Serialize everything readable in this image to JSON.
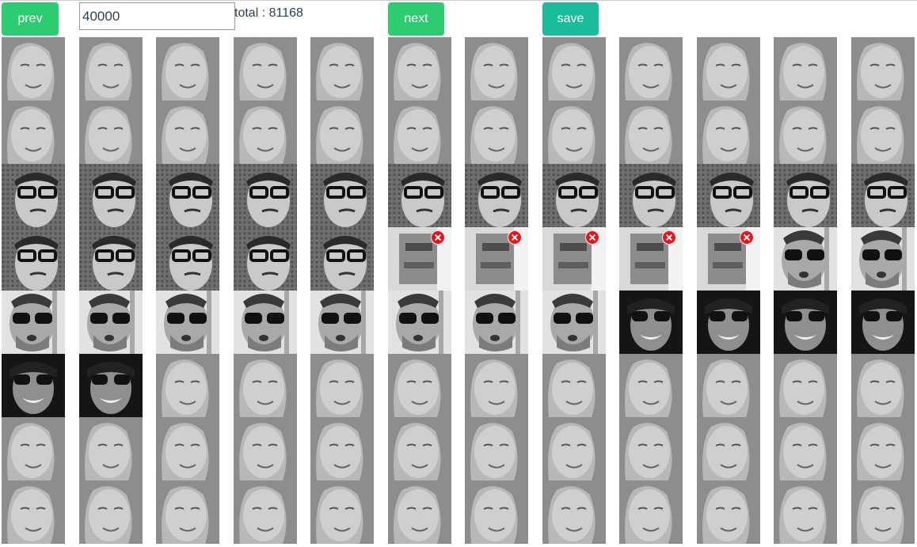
{
  "toolbar": {
    "prev_label": "prev",
    "next_label": "next",
    "save_label": "save",
    "page_value": "40000",
    "total_text": "total : 81168"
  },
  "colors": {
    "prev": "#2ecc71",
    "next": "#2ecc71",
    "save": "#1abc9c",
    "reject_mark": "#e8141c"
  },
  "grid": {
    "columns": 12,
    "rows": 8,
    "tiles": [
      [
        "blonde-woman",
        "blonde-woman",
        "blonde-woman",
        "blonde-woman",
        "blonde-woman",
        "blonde-woman",
        "blonde-woman",
        "blonde-woman",
        "blonde-woman",
        "blonde-woman",
        "blonde-woman",
        "blonde-woman"
      ],
      [
        "blonde-woman",
        "blonde-woman",
        "blonde-woman",
        "blonde-woman",
        "blonde-woman",
        "blonde-woman",
        "blonde-woman",
        "blonde-woman",
        "blonde-woman",
        "blonde-woman",
        "blonde-woman",
        "blonde-woman"
      ],
      [
        "man-glasses",
        "man-glasses",
        "man-glasses",
        "man-glasses",
        "man-glasses",
        "man-glasses",
        "man-glasses",
        "man-glasses",
        "man-glasses",
        "man-glasses",
        "man-glasses",
        "man-glasses"
      ],
      [
        "man-glasses",
        "man-glasses",
        "man-glasses",
        "man-glasses",
        "man-glasses",
        "rejected-blur",
        "rejected-blur",
        "rejected-blur",
        "rejected-blur",
        "rejected-blur",
        "man-sunglasses",
        "man-sunglasses"
      ],
      [
        "man-sunglasses",
        "man-sunglasses",
        "man-sunglasses",
        "man-sunglasses",
        "man-sunglasses",
        "man-sunglasses",
        "man-sunglasses",
        "man-sunglasses",
        "woman-sunglasses",
        "woman-sunglasses",
        "woman-sunglasses",
        "woman-sunglasses"
      ],
      [
        "woman-sunglasses",
        "woman-sunglasses",
        "blonde-woman",
        "blonde-woman",
        "blonde-woman",
        "blonde-woman",
        "blonde-woman",
        "blonde-woman",
        "blonde-woman",
        "blonde-woman",
        "blonde-woman",
        "blonde-woman"
      ],
      [
        "blonde-woman",
        "blonde-woman",
        "blonde-woman",
        "blonde-woman",
        "blonde-woman",
        "blonde-woman",
        "blonde-woman",
        "blonde-woman",
        "blonde-woman",
        "blonde-woman",
        "blonde-woman",
        "blonde-woman"
      ],
      [
        "blonde-woman",
        "blonde-woman",
        "blonde-woman",
        "blonde-woman",
        "blonde-woman",
        "blonde-woman",
        "blonde-woman",
        "blonde-woman",
        "blonde-woman",
        "blonde-woman",
        "blonde-woman",
        "blonde-woman"
      ]
    ],
    "rejected_icon": "close-circle-icon"
  }
}
